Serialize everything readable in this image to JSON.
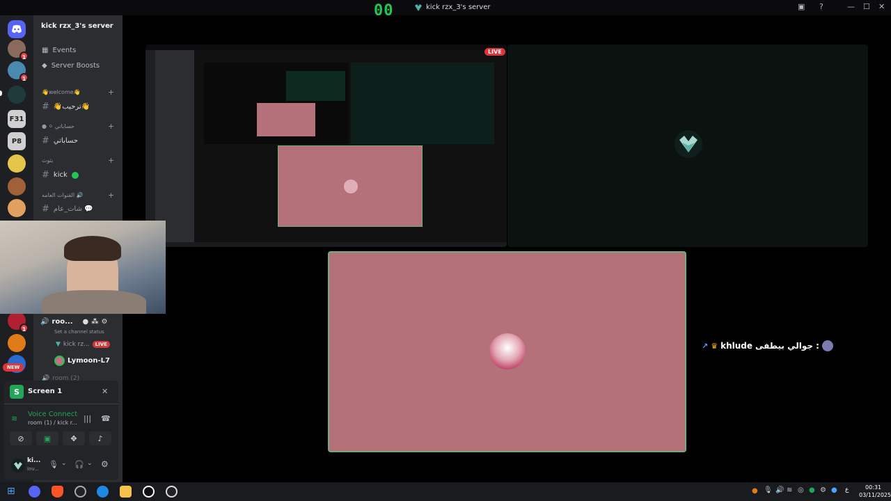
{
  "titlebar": {
    "counter": "00",
    "server_title": "kick rzx_3's server"
  },
  "rail": {
    "servers": [
      {
        "label": "",
        "color": "#8a6a5a",
        "badge": "1",
        "icon": "server-avatar"
      },
      {
        "label": "",
        "color": "#4a8ab0",
        "badge": "1",
        "icon": "server-avatar"
      },
      {
        "label": "",
        "color": "#1f3a3a",
        "badge": "",
        "icon": "server-avatar"
      },
      {
        "label": "F31",
        "color": "#d0d0d0",
        "badge": "",
        "icon": "server-logo"
      },
      {
        "label": "P8",
        "color": "#d0d0d0",
        "badge": "",
        "icon": "server-logo"
      },
      {
        "label": "",
        "color": "#e6c64a",
        "badge": "",
        "icon": "server-avatar"
      },
      {
        "label": "",
        "color": "#a0603a",
        "badge": "",
        "icon": "server-avatar"
      },
      {
        "label": "",
        "color": "#e0a060",
        "badge": "",
        "icon": "server-avatar"
      },
      {
        "label": "",
        "color": "#b02030",
        "badge": "1",
        "icon": "server-avatar"
      },
      {
        "label": "",
        "color": "#e07b1a",
        "badge": "",
        "icon": "server-avatar"
      },
      {
        "label": "",
        "color": "#2a6ad0",
        "badge": "",
        "icon": "server-avatar"
      }
    ],
    "new_badge": "NEW"
  },
  "sidebar": {
    "server_name": "kick rzx_3's server",
    "events": "Events",
    "boosts": "Server Boosts",
    "cat1": "👋welcome👋",
    "chan1": "👋ترحيب👋",
    "cat2": "حساباتي",
    "chan2": "حساباتي",
    "cat3": "بثوث",
    "chan3": "kick",
    "cat4": "القنوات العامه 🔊",
    "chan4": "شات_عام 💬",
    "voice_room": "roo...",
    "status_hint": "Set a channel status",
    "user1": "kick rz...",
    "live": "LIVE",
    "user2": "Lymoon-L7",
    "room2": "room (2)"
  },
  "panel": {
    "screen_title": "Screen 1",
    "voice_connected": "Voice Connecte",
    "voice_room": "room (1) / kick r...",
    "user_name": "ki...",
    "user_status": "Inv..."
  },
  "stage": {
    "live_badge": "LIVE",
    "overlay_name": "khlude",
    "overlay_text": "جوالي بيطفى :"
  },
  "taskbar": {
    "time": "00:31",
    "date": "03/11/2025",
    "lang": "ع"
  },
  "colors": {
    "accent_green": "#23c552",
    "live_red": "#da373c",
    "stream_pink": "#b5717a",
    "sidebar": "#2b2d31",
    "rail": "#1e1f22"
  }
}
